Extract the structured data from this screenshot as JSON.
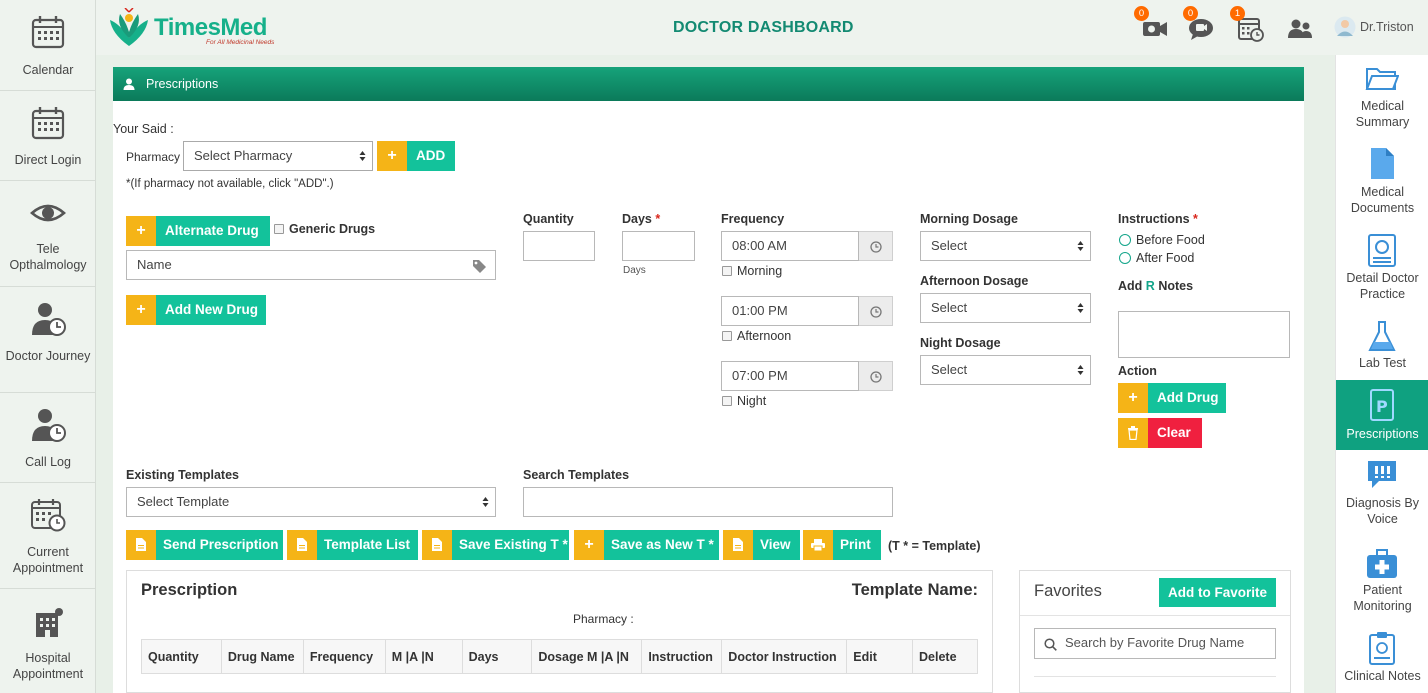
{
  "header": {
    "logo_main": "TimesMed",
    "logo_tag": "For All Medicinal Needs",
    "title": "DOCTOR DASHBOARD",
    "badges": {
      "video": "0",
      "chat": "0",
      "calendar": "1"
    },
    "user": "Dr.Triston"
  },
  "left_sidebar": [
    {
      "label": "Calendar",
      "icon": "calendar-icon"
    },
    {
      "label": "Direct Login",
      "icon": "calendar-grid-icon"
    },
    {
      "label": "Tele Opthalmology",
      "icon": "eye-icon"
    },
    {
      "label": "Doctor Journey",
      "icon": "user-clock-icon"
    },
    {
      "label": "Call Log",
      "icon": "user-clock-icon"
    },
    {
      "label": "Current Appointment",
      "icon": "calendar-clock-icon"
    },
    {
      "label": "Hospital Appointment",
      "icon": "hospital-icon"
    }
  ],
  "panel": {
    "title": "Prescriptions",
    "your_said": "Your Said :",
    "pharmacy_label": "Pharmacy",
    "pharmacy_select": "Select Pharmacy",
    "add_label": "ADD",
    "pharmacy_note": "*(If pharmacy not available, click \"ADD\".)",
    "alternate_drug": "Alternate Drug",
    "generic_drugs": "Generic Drugs",
    "name_placeholder": "Name",
    "add_new_drug": "Add New Drug",
    "quantity_label": "Quantity",
    "days_label": "Days",
    "days_sub": "Days",
    "frequency_label": "Frequency",
    "times": [
      {
        "time": "08:00 AM",
        "label": "Morning"
      },
      {
        "time": "01:00 PM",
        "label": "Afternoon"
      },
      {
        "time": "07:00 PM",
        "label": "Night"
      }
    ],
    "morning_dosage": "Morning Dosage",
    "afternoon_dosage": "Afternoon Dosage",
    "night_dosage": "Night Dosage",
    "select": "Select",
    "instructions_label": "Instructions",
    "before_food": "Before Food",
    "after_food": "After Food",
    "add_notes_pre": "Add",
    "add_notes_rx": "R",
    "add_notes_post": "Notes",
    "action_label": "Action",
    "add_drug": "Add Drug",
    "clear": "Clear",
    "existing_templates": "Existing Templates",
    "select_template": "Select Template",
    "search_templates": "Search Templates",
    "buttons": {
      "send": "Send Prescription",
      "template_list": "Template List",
      "save_existing": "Save Existing T *",
      "save_new": "Save as New T *",
      "view": "View",
      "print": "Print"
    },
    "template_note": "(T * = Template)"
  },
  "prescription": {
    "title": "Prescription",
    "template_name": "Template Name:",
    "pharmacy": "Pharmacy :",
    "columns": [
      "Quantity",
      "Drug Name",
      "Frequency",
      "M |A |N",
      "Days",
      "Dosage M |A |N",
      "Instruction",
      "Doctor Instruction",
      "Edit",
      "Delete"
    ]
  },
  "favorites": {
    "title": "Favorites",
    "add_button": "Add to Favorite",
    "search_placeholder": "Search by Favorite Drug Name"
  },
  "right_sidebar": [
    {
      "label": "Medical Summary",
      "icon": "folder-icon"
    },
    {
      "label": "Medical Documents",
      "icon": "document-icon"
    },
    {
      "label": "Detail Doctor Practice",
      "icon": "certificate-icon"
    },
    {
      "label": "Lab Test",
      "icon": "flask-icon"
    },
    {
      "label": "Prescriptions",
      "icon": "prescription-icon",
      "active": true
    },
    {
      "label": "Diagnosis By Voice",
      "icon": "voice-chat-icon"
    },
    {
      "label": "Patient Monitoring",
      "icon": "medical-kit-icon"
    },
    {
      "label": "Clinical Notes",
      "icon": "clipboard-icon"
    }
  ],
  "colors": {
    "accent": "#13c29b",
    "header_green": "#0b7a5a",
    "button_icon": "#f5b417",
    "danger": "#f0203f",
    "badge": "#ff6a00"
  }
}
